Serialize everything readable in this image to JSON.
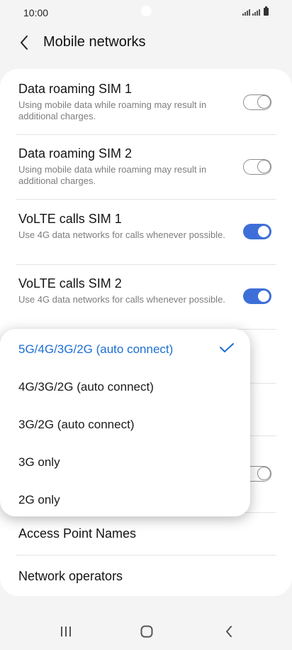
{
  "status_bar": {
    "time": "10:00"
  },
  "header": {
    "title": "Mobile networks"
  },
  "settings": [
    {
      "title": "Data roaming SIM 1",
      "desc": "Using mobile data while roaming may result in additional charges.",
      "toggle": "off"
    },
    {
      "title": "Data roaming SIM 2",
      "desc": "Using mobile data while roaming may result in additional charges.",
      "toggle": "off"
    },
    {
      "title": "VoLTE calls SIM 1",
      "desc": "Use 4G data networks for calls whenever possible.",
      "toggle": "on"
    },
    {
      "title": "VoLTE calls SIM 2",
      "desc": "Use 4G data networks for calls whenever possible.",
      "toggle": "on"
    }
  ],
  "links": {
    "access_point_names": "Access Point Names",
    "network_operators": "Network operators"
  },
  "network_mode_menu": {
    "options": [
      "5G/4G/3G/2G (auto connect)",
      "4G/3G/2G (auto connect)",
      "3G/2G (auto connect)",
      "3G only",
      "2G only"
    ],
    "selected_index": 0
  },
  "colors": {
    "accent": "#1c6ed4",
    "toggle_on": "#3e6fd8",
    "background": "#f4f4f4"
  }
}
